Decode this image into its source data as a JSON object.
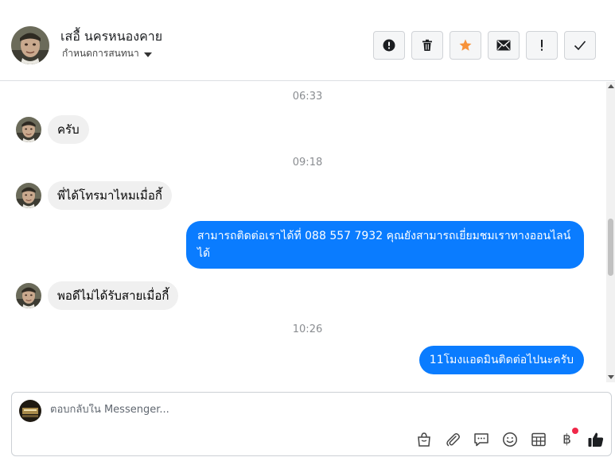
{
  "header": {
    "contact_name": "เสอื้ นครหนองคาย",
    "assign_label": "กำหนดการสนทนา",
    "actions": [
      {
        "name": "spam-alert",
        "icon": "alert-circle-icon"
      },
      {
        "name": "delete",
        "icon": "trash-icon"
      },
      {
        "name": "star",
        "icon": "star-icon"
      },
      {
        "name": "mark-unread",
        "icon": "envelope-icon"
      },
      {
        "name": "follow-up",
        "icon": "exclamation-icon"
      },
      {
        "name": "mark-done",
        "icon": "check-icon"
      }
    ]
  },
  "thread": {
    "items": [
      {
        "type": "time",
        "text": "06:33"
      },
      {
        "type": "incoming",
        "text": "ครับ"
      },
      {
        "type": "time",
        "text": "09:18"
      },
      {
        "type": "incoming",
        "text": "พี่ได้โทรมาไหมเมื่อกี้"
      },
      {
        "type": "outgoing",
        "text": "สามารถติดต่อเราได้ที่ 088 557 7932 คุณยังสามารถเยี่ยมชมเราทางออนไลน์ได้"
      },
      {
        "type": "incoming",
        "text": "พอดีไม่ได้รับสายเมื่อกี้"
      },
      {
        "type": "time",
        "text": "10:26"
      },
      {
        "type": "outgoing",
        "text": "11โมงแอดมินติดต่อไปนะครับ"
      }
    ]
  },
  "composer": {
    "placeholder": "ตอบกลับใน Messenger...",
    "value": "",
    "tools": [
      "shopping-bag-icon",
      "paperclip-icon",
      "chat-bubble-icon",
      "emoji-icon",
      "table-icon",
      "baht-icon",
      "thumbs-up-icon"
    ],
    "baht_symbol": "฿"
  },
  "colors": {
    "accent": "#0a7cff",
    "star": "#f7923a",
    "incoming_bubble": "#f0f0f0",
    "notification_dot": "#f02849"
  }
}
